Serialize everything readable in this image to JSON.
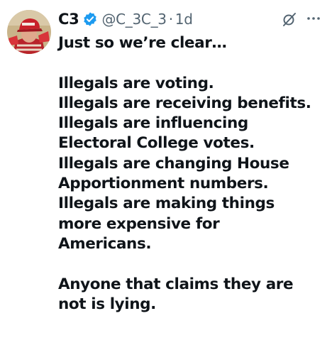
{
  "tweet": {
    "author": {
      "display_name": "C3",
      "handle": "@C_3C_3",
      "verified": true,
      "badge_color": "#1d9bf0",
      "avatar_icon": "avatar-photo"
    },
    "separator": "·",
    "time": "1d",
    "header_icons": [
      "grok-icon",
      "more-icon"
    ],
    "text_lines": [
      "Just so we’re clear…",
      "",
      "Illegals are voting.",
      "Illegals are receiving benefits.",
      "Illegals are influencing",
      "Electoral College votes.",
      "Illegals are changing House",
      "Apportionment numbers.",
      "Illegals are making things",
      "more expensive for",
      "Americans.",
      "",
      "Anyone that claims they are",
      "not is lying."
    ]
  }
}
